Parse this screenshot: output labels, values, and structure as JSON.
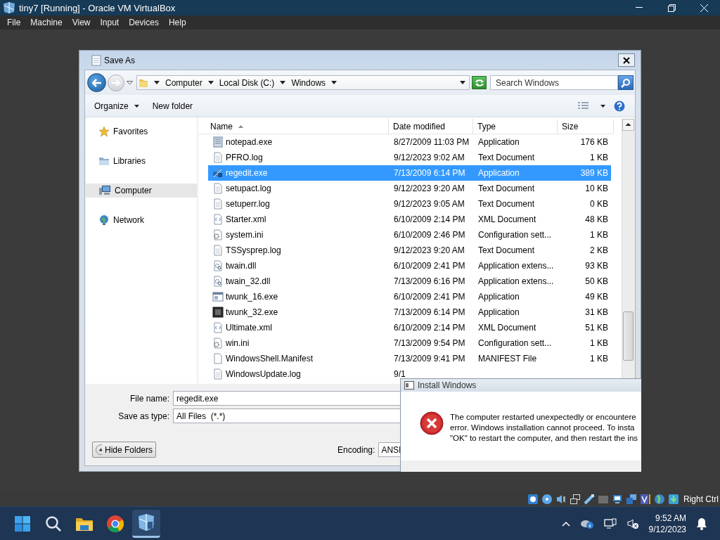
{
  "host": {
    "title": "tiny7 [Running] - Oracle VM VirtualBox",
    "menu": [
      "File",
      "Machine",
      "View",
      "Input",
      "Devices",
      "Help"
    ],
    "host_key": "Right Ctrl"
  },
  "save_as": {
    "title": "Save As",
    "breadcrumb": [
      "Computer",
      "Local Disk (C:)",
      "Windows"
    ],
    "search": {
      "placeholder": "Search Windows"
    },
    "toolbar": [
      "Organize",
      "New folder"
    ],
    "nav": [
      {
        "label": "Favorites",
        "kind": "star",
        "selected": false
      },
      {
        "label": "Libraries",
        "kind": "library",
        "selected": false
      },
      {
        "label": "Computer",
        "kind": "computer",
        "selected": true
      },
      {
        "label": "Network",
        "kind": "network",
        "selected": false
      }
    ],
    "columns": [
      "Name",
      "Date modified",
      "Type",
      "Size"
    ],
    "rows": [
      {
        "name": "notepad.exe",
        "date": "8/27/2009 11:03 PM",
        "type": "Application",
        "size": "176 KB",
        "kind": "notepad",
        "selected": false
      },
      {
        "name": "PFRO.log",
        "date": "9/12/2023 9:02 AM",
        "type": "Text Document",
        "size": "1 KB",
        "kind": "text",
        "selected": false
      },
      {
        "name": "regedit.exe",
        "date": "7/13/2009 6:14 PM",
        "type": "Application",
        "size": "389 KB",
        "kind": "regedit",
        "selected": true
      },
      {
        "name": "setupact.log",
        "date": "9/12/2023 9:20 AM",
        "type": "Text Document",
        "size": "10 KB",
        "kind": "text",
        "selected": false
      },
      {
        "name": "setuperr.log",
        "date": "9/12/2023 9:05 AM",
        "type": "Text Document",
        "size": "0 KB",
        "kind": "text",
        "selected": false
      },
      {
        "name": "Starter.xml",
        "date": "6/10/2009 2:14 PM",
        "type": "XML Document",
        "size": "48 KB",
        "kind": "xml",
        "selected": false
      },
      {
        "name": "system.ini",
        "date": "6/10/2009 2:46 PM",
        "type": "Configuration sett...",
        "size": "1 KB",
        "kind": "config",
        "selected": false
      },
      {
        "name": "TSSysprep.log",
        "date": "9/12/2023 9:20 AM",
        "type": "Text Document",
        "size": "2 KB",
        "kind": "text",
        "selected": false
      },
      {
        "name": "twain.dll",
        "date": "6/10/2009 2:41 PM",
        "type": "Application extens...",
        "size": "93 KB",
        "kind": "dll",
        "selected": false
      },
      {
        "name": "twain_32.dll",
        "date": "7/13/2009 6:16 PM",
        "type": "Application extens...",
        "size": "50 KB",
        "kind": "dll",
        "selected": false
      },
      {
        "name": "twunk_16.exe",
        "date": "6/10/2009 2:41 PM",
        "type": "Application",
        "size": "49 KB",
        "kind": "window",
        "selected": false
      },
      {
        "name": "twunk_32.exe",
        "date": "7/13/2009 6:14 PM",
        "type": "Application",
        "size": "31 KB",
        "kind": "dark",
        "selected": false
      },
      {
        "name": "Ultimate.xml",
        "date": "6/10/2009 2:14 PM",
        "type": "XML Document",
        "size": "51 KB",
        "kind": "xml",
        "selected": false
      },
      {
        "name": "win.ini",
        "date": "7/13/2009 9:54 PM",
        "type": "Configuration sett...",
        "size": "1 KB",
        "kind": "config",
        "selected": false
      },
      {
        "name": "WindowsShell.Manifest",
        "date": "7/13/2009 9:41 PM",
        "type": "MANIFEST File",
        "size": "1 KB",
        "kind": "blank",
        "selected": false
      },
      {
        "name": "WindowsUpdate.log",
        "date": "9/1",
        "kind": "text",
        "selected": false
      }
    ],
    "file_name": {
      "label": "File name:",
      "value": "regedit.exe"
    },
    "save_type": {
      "label": "Save as type:",
      "value": "All Files  (*.*)"
    },
    "hide_folders": "Hide Folders",
    "encoding": {
      "label": "Encoding:",
      "value": "ANSI"
    }
  },
  "install_dialog": {
    "title": "Install Windows",
    "message_lines": [
      "The computer restarted unexpectedly or encountere",
      "error. Windows installation cannot proceed. To insta",
      "\"OK\" to restart the computer, and then restart the ins"
    ]
  },
  "taskbar": {
    "time": "9:52 AM",
    "date": "9/12/2023"
  }
}
